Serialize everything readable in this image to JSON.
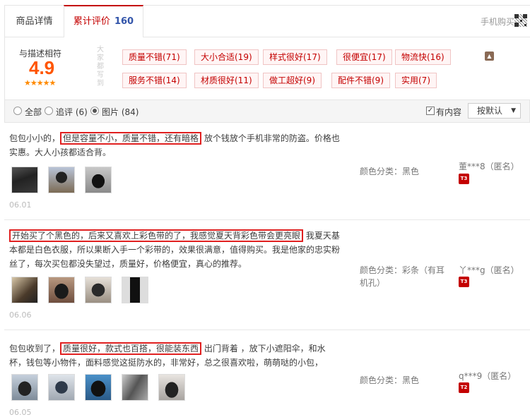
{
  "tabs": {
    "details": "商品详情",
    "reviews": "累计评价",
    "review_count": "160",
    "mobile_buy": "手机购买"
  },
  "summary": {
    "score_label": "与描述相符",
    "score": "4.9",
    "stars": "★★★★★",
    "vertical_label": "大家都写到",
    "tags": [
      "质量不错(71)",
      "大小合适(19)",
      "样式很好(17)",
      "很便宜(17)",
      "物流快(16)",
      "服务不错(14)",
      "材质很好(11)",
      "做工超好(9)",
      "配件不错(9)",
      "实用(7)"
    ]
  },
  "filter": {
    "all": "全部",
    "followup": "追评 (6)",
    "pictures": "图片 (84)",
    "has_content": "有内容",
    "sort": "按默认"
  },
  "reviews": [
    {
      "pre": "包包小小的，",
      "highlight": "但是容量不小，质量不错，还有暗格",
      "post": " 放个钱放个手机非常的防盗。价格也实惠。大人小孩都适合背。",
      "date": "06.01",
      "color": "颜色分类：黑色",
      "user": "董***8（匿名）",
      "badge": "T3"
    },
    {
      "pre": "",
      "highlight": "开始买了个黑色的，后来又喜欢上彩色带的了，我感觉夏天背彩色带会更亮眼",
      "post": " 我夏天基本都是白色衣服，所以果断入手一个彩带的，效果很满意，值得购买。我是他家的忠实粉丝了，每次买包都没失望过，质量好，价格便宜，真心的推荐。",
      "date": "06.06",
      "color": "颜色分类：彩条（有耳机孔）",
      "user": "丫***g（匿名）",
      "badge": "T3"
    },
    {
      "pre": "包包收到了，",
      "highlight": "质量很好，款式也百搭，很能装东西",
      "post": " 出门背着 ，放下小遮阳伞，和水杯，钱包等小物件，面料感觉这挺防水的，非常好，总之很喜欢啦，萌萌哒的小包，",
      "date": "06.05",
      "color": "颜色分类：黑色",
      "user": "q***9（匿名）",
      "badge": "T2"
    }
  ]
}
